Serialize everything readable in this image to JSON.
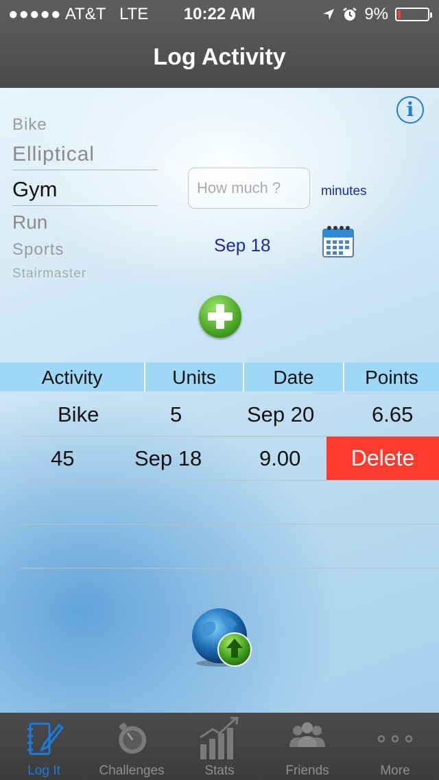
{
  "status_bar": {
    "signal": "●●●●●",
    "carrier": "AT&T",
    "network": "LTE",
    "time": "10:22 AM",
    "battery_percent": "9%",
    "battery_level": 0.09,
    "battery_color": "#ff3b30",
    "icons": [
      "location-arrow-icon",
      "alarm-icon"
    ]
  },
  "nav": {
    "title": "Log Activity"
  },
  "activity_picker": {
    "items": [
      "Bike",
      "Elliptical",
      "Gym",
      "Run",
      "Sports",
      "Stairmaster"
    ],
    "selected": "Gym"
  },
  "amount_input": {
    "placeholder": "How much ?",
    "value": ""
  },
  "unit_label": "minutes",
  "selected_date": "Sep 18",
  "table": {
    "headers": [
      "Activity",
      "Units",
      "Date",
      "Points"
    ],
    "rows": [
      {
        "activity": "Bike",
        "units": "5",
        "date": "Sep 20",
        "points": "6.65"
      },
      {
        "activity": "",
        "units": "45",
        "date": "Sep 18",
        "points": "9.00"
      }
    ],
    "delete_label": "Delete"
  },
  "tabs": [
    {
      "label": "Log It",
      "icon": "notebook-pencil-icon",
      "active": true
    },
    {
      "label": "Challenges",
      "icon": "stopwatch-icon",
      "active": false
    },
    {
      "label": "Stats",
      "icon": "bar-chart-icon",
      "active": false
    },
    {
      "label": "Friends",
      "icon": "people-icon",
      "active": false
    },
    {
      "label": "More",
      "icon": "more-dots-icon",
      "active": false
    }
  ],
  "colors": {
    "accent": "#1a7be0",
    "delete": "#ff3b30",
    "header_row": "#9fd8f6",
    "link_text": "#1b2ba8"
  }
}
